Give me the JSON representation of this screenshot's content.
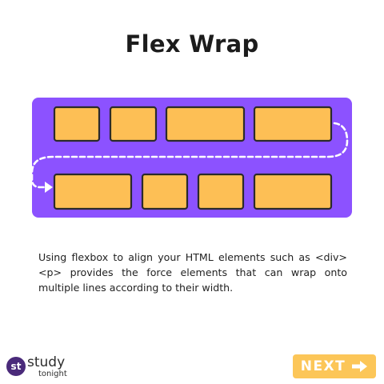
{
  "page": {
    "title": "Flex Wrap",
    "description": "Using flexbox to align your HTML elements such as <div><p> provides the force elements that can wrap onto multiple lines according to their width."
  },
  "diagram": {
    "container_color": "#8c52ff",
    "item_color": "#fdbf55",
    "item_border": "#2b2b2b",
    "row1_items": 4,
    "row2_items": 4,
    "wrap_arrow": "dashed-wrap-arrow"
  },
  "brand": {
    "logo_mark": "st",
    "name_line1": "study",
    "name_line2": "tonight"
  },
  "nav": {
    "next_label": "NEXT",
    "next_icon": "arrow-right-icon",
    "next_color": "#fcc658"
  }
}
